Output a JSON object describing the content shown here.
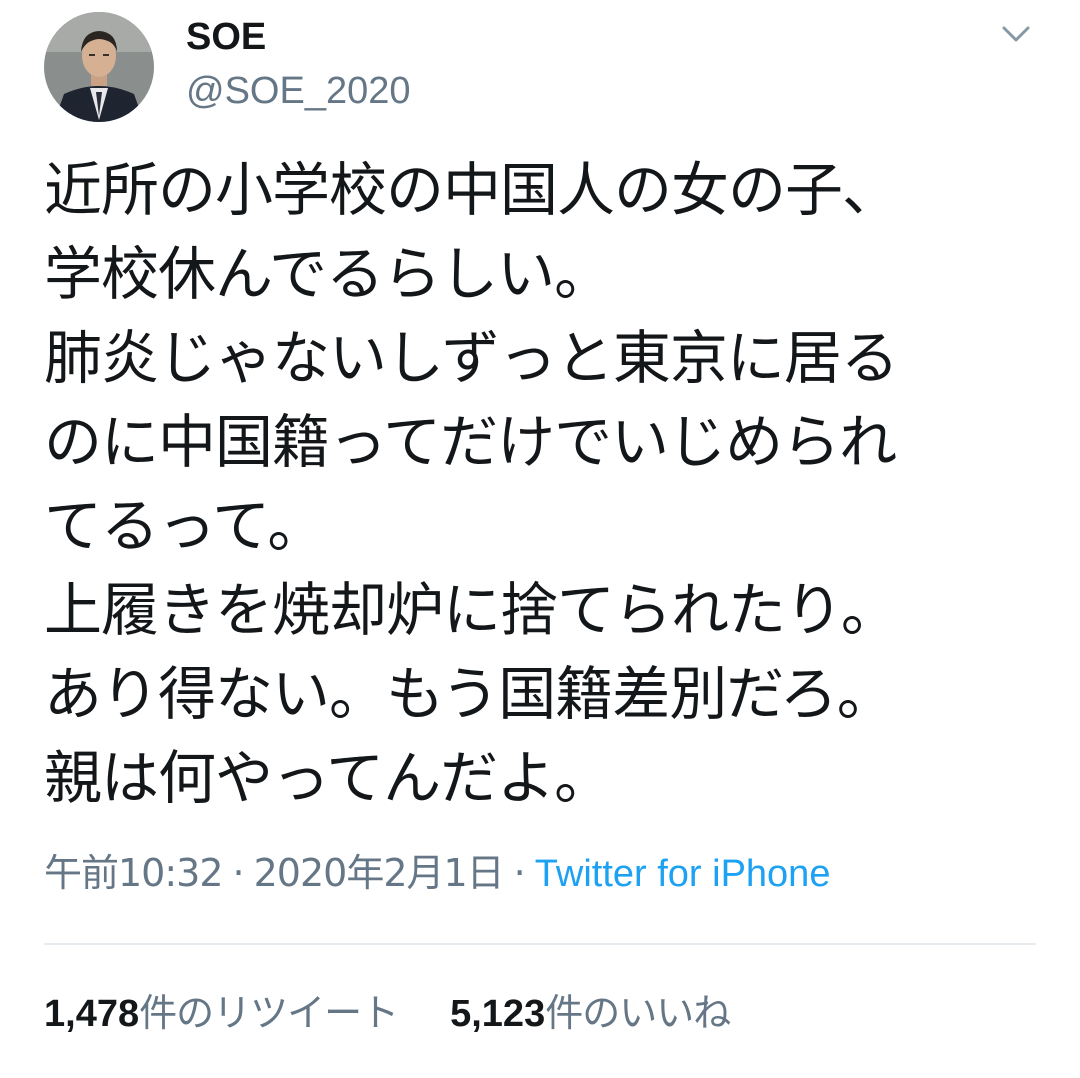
{
  "author": {
    "display_name": "SOE",
    "handle": "@SOE_2020",
    "avatar_icon": "profile-photo-man-in-suit"
  },
  "menu": {
    "icon": "chevron-down-icon"
  },
  "tweet": {
    "lines": [
      "近所の小学校の中国人の女の子、",
      "学校休んでるらしい。",
      "肺炎じゃないしずっと東京に居る",
      "のに中国籍ってだけでいじめられ",
      "てるって。",
      "上履きを焼却炉に捨てられたり。",
      "あり得ない。もう国籍差別だろ。",
      "親は何やってんだよ。"
    ]
  },
  "meta": {
    "time": "午前10:32",
    "separator": "·",
    "date": "2020年2月1日",
    "source": "Twitter for iPhone"
  },
  "stats": {
    "retweets_count": "1,478",
    "retweets_label": "件のリツイート",
    "likes_count": "5,123",
    "likes_label": "件のいいね"
  },
  "colors": {
    "text": "#14171a",
    "secondary": "#657786",
    "link": "#1da1f2",
    "divider": "#e6ecf0",
    "background": "#ffffff"
  }
}
